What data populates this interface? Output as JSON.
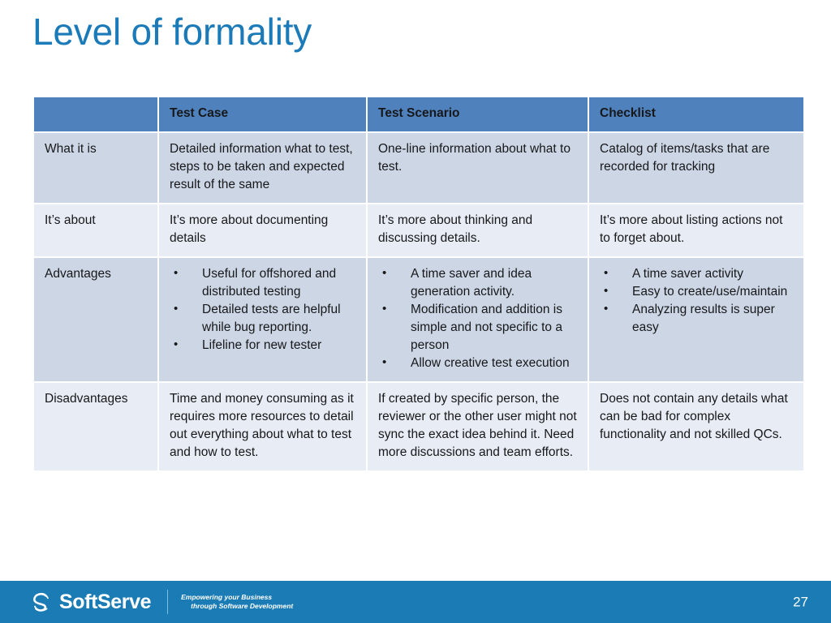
{
  "slide": {
    "title": "Level of formality",
    "title_color": "#1B7AB8",
    "page_number": "27"
  },
  "table": {
    "header_bg": "#4F81BD",
    "band_dark": "#CDD6E5",
    "band_light": "#E8ECF4",
    "headers": [
      "",
      "Test Case",
      "Test Scenario",
      "Checklist"
    ],
    "rows": [
      {
        "label": "What it is",
        "test_case": "Detailed information what to test, steps to be taken and expected result of the same",
        "test_scenario": "One-line information about what to test.",
        "checklist": "Catalog of items/tasks that are recorded for tracking"
      },
      {
        "label": "It’s about",
        "test_case": "It’s more about documenting details",
        "test_scenario": "It’s more about thinking and discussing details.",
        "checklist": "It’s more about listing actions not to forget about."
      },
      {
        "label": "Advantages",
        "test_case_bullets": [
          "Useful for offshored and distributed testing",
          "Detailed tests are helpful while bug reporting.",
          "Lifeline for new tester"
        ],
        "test_scenario_bullets": [
          "A time saver and idea generation activity.",
          "Modification and addition is simple and not specific to a person",
          "Allow creative test execution"
        ],
        "checklist_bullets": [
          "A time saver  activity",
          "Easy to create/use/maintain",
          "Analyzing results is super easy"
        ]
      },
      {
        "label": "Disadvantages",
        "test_case": "Time and money consuming as it requires more resources to detail out everything about what to test and how to test.",
        "test_scenario": "If created by specific person, the reviewer or the other user might not sync the exact idea behind it. Need more discussions and team efforts.",
        "checklist": "Does not contain any details what can be bad for complex functionality and not skilled QCs."
      }
    ]
  },
  "footer": {
    "bar_color": "#1A7BB5",
    "brand_name": "SoftServe",
    "tagline_line1": "Empowering your Business",
    "tagline_line2": "through Software Development"
  }
}
